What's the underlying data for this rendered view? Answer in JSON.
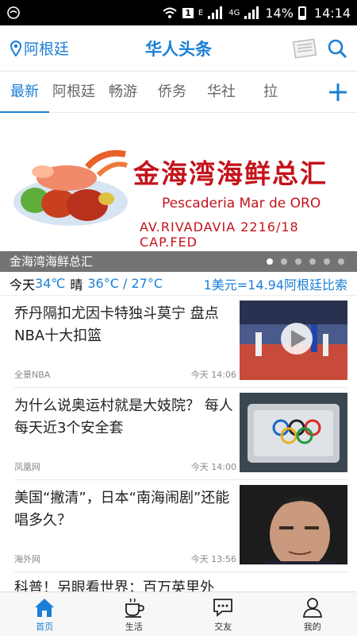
{
  "status_bar": {
    "network_type": "4G",
    "sim_label": "E",
    "battery": "14%",
    "time": "14:14"
  },
  "app_bar": {
    "location": "阿根廷",
    "title": "华人头条"
  },
  "tabs": [
    "最新",
    "阿根廷",
    "畅游",
    "侨务",
    "华社",
    "拉"
  ],
  "banner": {
    "chinese_title": "金海湾海鲜总汇",
    "spanish_name": "Pescaderia Mar de ORO",
    "address": "AV.RIVADAVIA  2216/18 CAP.FED",
    "caption": "金海湾海鲜总汇",
    "slide_count": 6,
    "active_slide": 0
  },
  "weather": {
    "day": "今天",
    "temp": "34℃",
    "condition": "晴",
    "range": "36°C / 27°C",
    "exchange": "1美元=14.94阿根廷比索"
  },
  "news": [
    {
      "headline": "乔丹隔扣尤因卡特独斗莫宁 盘点NBA十大扣篮",
      "source": "全景NBA",
      "time": "今天  14:06"
    },
    {
      "headline": "为什么说奥运村就是大妓院？ 每人每天近3个安全套",
      "source": "凤凰网",
      "time": "今天  14:00"
    },
    {
      "headline": "美国“撇清”，日本“南海闹剧”还能唱多久？",
      "source": "海外网",
      "time": "今天  13:56"
    }
  ],
  "partial_item": {
    "headline": "科普！另眼看世界：百万英里外"
  },
  "bottom_nav": [
    "首页",
    "生活",
    "交友",
    "我的"
  ],
  "colors": {
    "accent": "#1a7fd6",
    "banner_red": "#c4131b"
  }
}
